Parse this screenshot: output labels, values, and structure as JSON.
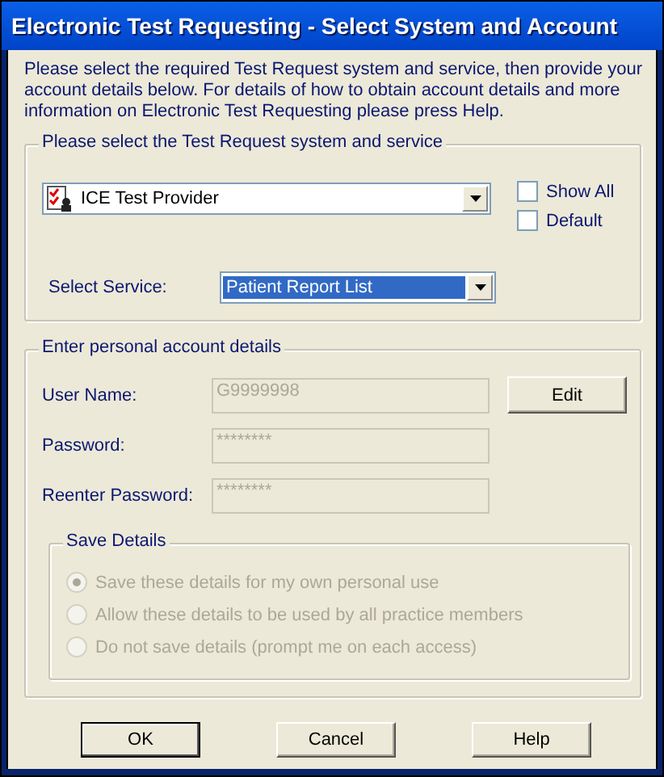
{
  "window": {
    "title": "Electronic Test Requesting - Select System and Account"
  },
  "intro": "Please select the required Test Request system and service, then provide your account details below. For details of how to obtain account details and more information on Electronic Test Requesting please press Help.",
  "system_group": {
    "legend": "Please select the Test Request system and service",
    "provider": {
      "value": "ICE Test Provider"
    },
    "checkboxes": [
      {
        "label": "Show All",
        "checked": false
      },
      {
        "label": "Default",
        "checked": false
      }
    ],
    "service": {
      "label": "Select Service:",
      "value": "Patient Report List",
      "selected": true
    }
  },
  "account_group": {
    "legend": "Enter personal account details",
    "fields": [
      {
        "label": "User Name:",
        "value": "G9999998",
        "disabled": true
      },
      {
        "label": "Password:",
        "value": "********",
        "disabled": true
      },
      {
        "label": "Reenter Password:",
        "value": "********",
        "disabled": true
      }
    ],
    "edit_button": "Edit",
    "save_details": {
      "legend": "Save Details",
      "options": [
        {
          "label": "Save these details for my own personal use",
          "selected": true,
          "disabled": true
        },
        {
          "label": "Allow these details to be used by all practice members",
          "selected": false,
          "disabled": true
        },
        {
          "label": "Do not save details (prompt me on each access)",
          "selected": false,
          "disabled": true
        }
      ]
    }
  },
  "buttons": [
    {
      "label": "OK",
      "default": true
    },
    {
      "label": "Cancel",
      "default": false
    },
    {
      "label": "Help",
      "default": false
    }
  ]
}
